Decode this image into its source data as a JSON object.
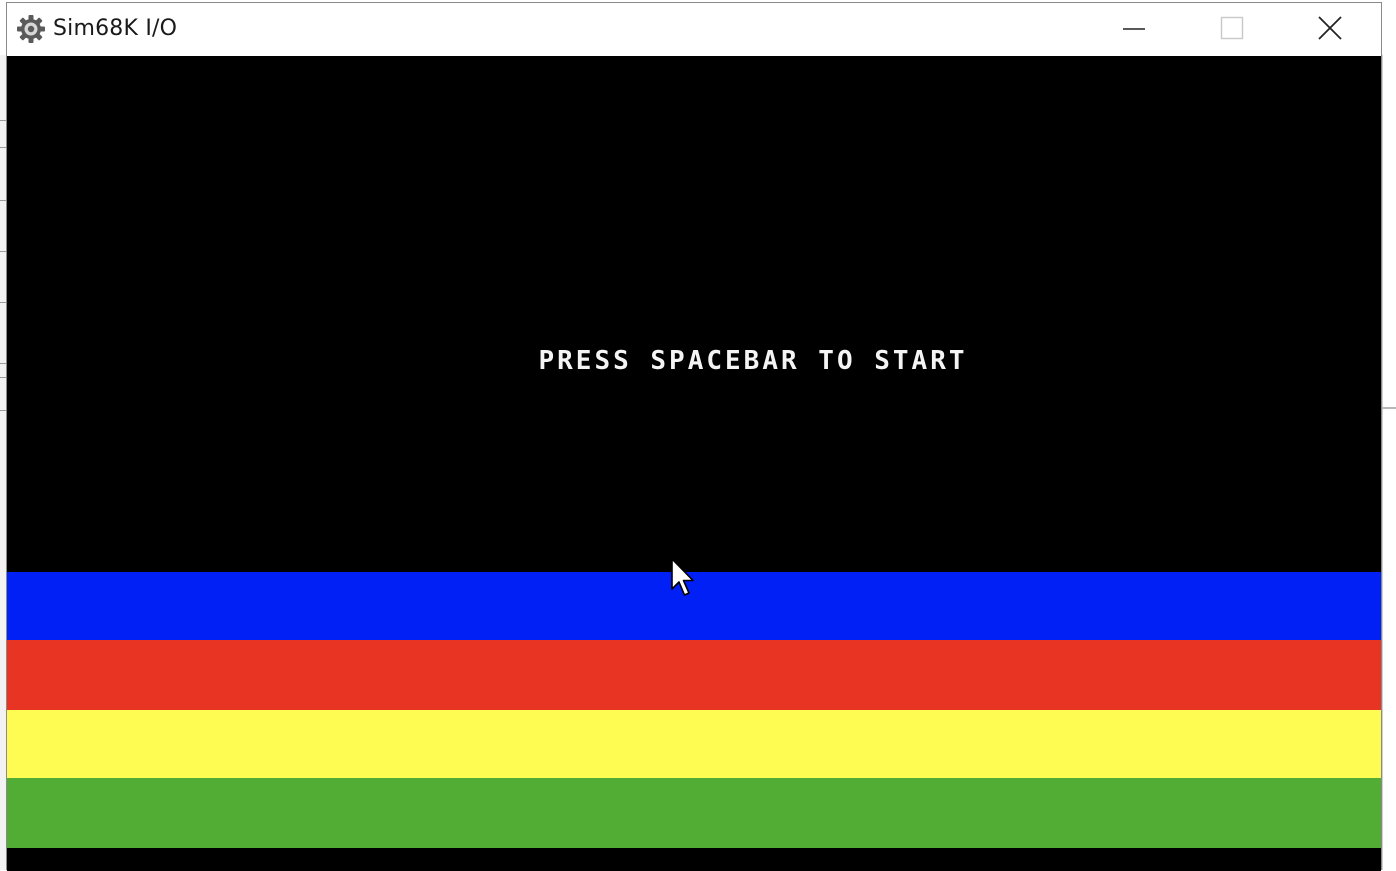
{
  "window": {
    "title": "Sim68K I/O",
    "icon": "gear-icon",
    "controls": {
      "minimize": "minimize-icon",
      "maximize": "maximize-icon",
      "close": "close-icon"
    }
  },
  "screen": {
    "prompt": "PRESS SPACEBAR TO START",
    "background": "#000000",
    "text_color": "#f4f4f4",
    "stripes": [
      {
        "name": "blue",
        "color": "#0120f5"
      },
      {
        "name": "red",
        "color": "#e83423"
      },
      {
        "name": "yellow",
        "color": "#fefb53"
      },
      {
        "name": "green",
        "color": "#51ad33"
      }
    ]
  },
  "pointer": {
    "icon": "mouse-pointer-icon"
  }
}
